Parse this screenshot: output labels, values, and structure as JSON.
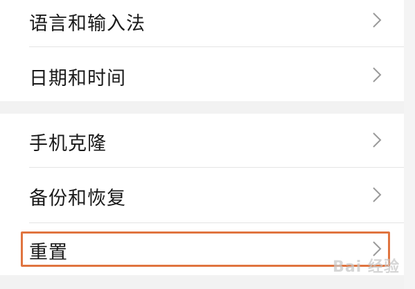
{
  "settings": {
    "group_one": [
      {
        "label": "语言和输入法",
        "icon": "chevron-right-icon"
      },
      {
        "label": "日期和时间",
        "icon": "chevron-right-icon"
      }
    ],
    "group_two": [
      {
        "label": "手机克隆",
        "icon": "chevron-right-icon"
      },
      {
        "label": "备份和恢复",
        "icon": "chevron-right-icon"
      },
      {
        "label": "重置",
        "icon": "chevron-right-icon",
        "highlighted": true
      }
    ]
  },
  "highlight": {
    "color": "#e0743f",
    "target": "重置"
  },
  "watermark": {
    "text": "Bai 经验",
    "icon": "baidu-paw-icon"
  }
}
